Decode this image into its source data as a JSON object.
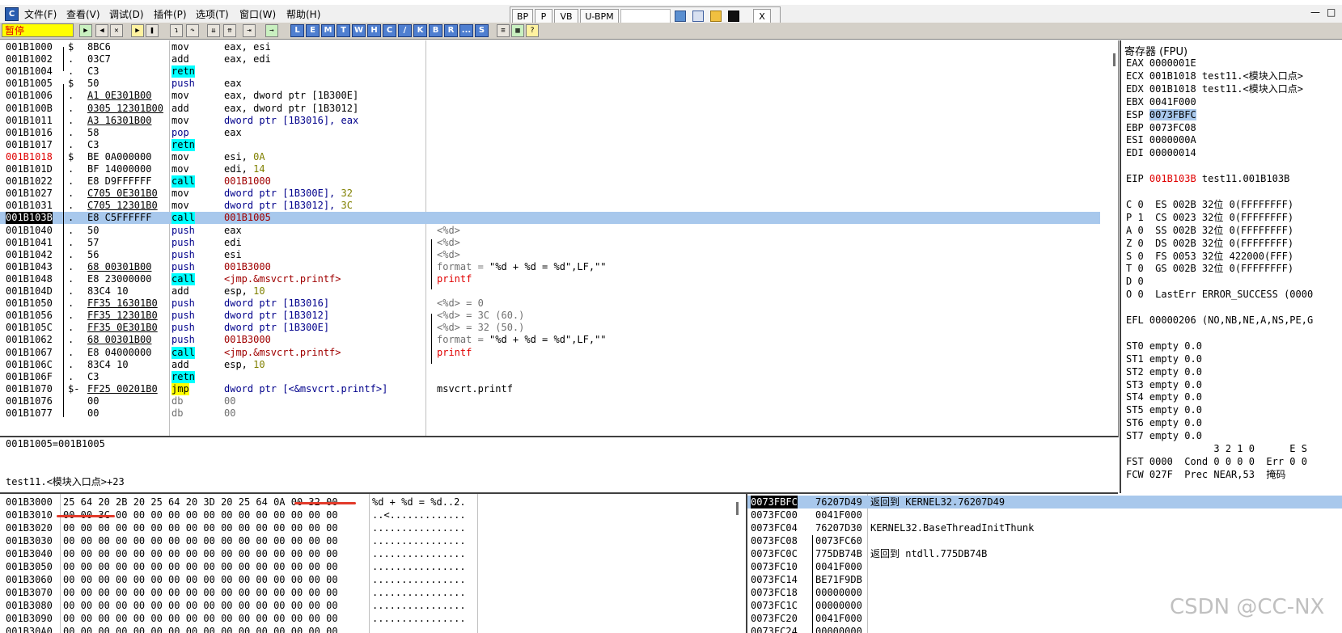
{
  "menu": {
    "items": [
      "文件(F)",
      "查看(V)",
      "调试(D)",
      "插件(P)",
      "选项(T)",
      "窗口(W)",
      "帮助(H)"
    ],
    "window_buttons": [
      "—",
      "□"
    ]
  },
  "plugin_bar": {
    "buttons": [
      "BP",
      "P",
      "VB",
      "U-BPM"
    ],
    "close": "X"
  },
  "toolbar": {
    "status": "暂停",
    "letters": [
      "L",
      "E",
      "M",
      "T",
      "W",
      "H",
      "C",
      "/",
      "K",
      "B",
      "R",
      "...",
      "S"
    ]
  },
  "cpu": {
    "rows": [
      {
        "addr": "001B1000",
        "mark": "$",
        "hex": "8BC6",
        "mn": "mov",
        "op": "eax, esi",
        "cm": ""
      },
      {
        "addr": "001B1002",
        "mark": ".",
        "hex": "03C7",
        "mn": "add",
        "op": "eax, edi",
        "cm": ""
      },
      {
        "addr": "001B1004",
        "mark": ".",
        "hex": "C3",
        "mn": "retn",
        "op": "",
        "cm": ""
      },
      {
        "addr": "001B1005",
        "mark": "$",
        "hex": "50",
        "mn": "push",
        "op": "eax",
        "cm": ""
      },
      {
        "addr": "001B1006",
        "mark": ".",
        "hex": "A1 0E301B00",
        "mn": "mov",
        "op": "eax, dword ptr [1B300E]",
        "cm": ""
      },
      {
        "addr": "001B100B",
        "mark": ".",
        "hex": "0305 12301B00",
        "mn": "add",
        "op": "eax, dword ptr [1B3012]",
        "cm": ""
      },
      {
        "addr": "001B1011",
        "mark": ".",
        "hex": "A3 16301B00",
        "mn": "mov",
        "op": "dword ptr [1B3016], eax",
        "cm": ""
      },
      {
        "addr": "001B1016",
        "mark": ".",
        "hex": "58",
        "mn": "pop",
        "op": "eax",
        "cm": ""
      },
      {
        "addr": "001B1017",
        "mark": ".",
        "hex": "C3",
        "mn": "retn",
        "op": "",
        "cm": ""
      },
      {
        "addr": "001B1018",
        "mark": "$",
        "hex": "BE 0A000000",
        "mn": "mov",
        "op": "esi, 0A",
        "cm": ""
      },
      {
        "addr": "001B101D",
        "mark": ".",
        "hex": "BF 14000000",
        "mn": "mov",
        "op": "edi, 14",
        "cm": ""
      },
      {
        "addr": "001B1022",
        "mark": ".",
        "hex": "E8 D9FFFFFF",
        "mn": "call",
        "op": "001B1000",
        "cm": ""
      },
      {
        "addr": "001B1027",
        "mark": ".",
        "hex": "C705 0E301B0",
        "mn": "mov",
        "op": "dword ptr [1B300E], 32",
        "cm": ""
      },
      {
        "addr": "001B1031",
        "mark": ".",
        "hex": "C705 12301B0",
        "mn": "mov",
        "op": "dword ptr [1B3012], 3C",
        "cm": ""
      },
      {
        "addr": "001B103B",
        "mark": ".",
        "hex": "E8 C5FFFFFF",
        "mn": "call",
        "op": "001B1005",
        "cm": ""
      },
      {
        "addr": "001B1040",
        "mark": ".",
        "hex": "50",
        "mn": "push",
        "op": "eax",
        "cm": "<%d>"
      },
      {
        "addr": "001B1041",
        "mark": ".",
        "hex": "57",
        "mn": "push",
        "op": "edi",
        "cm": "<%d>"
      },
      {
        "addr": "001B1042",
        "mark": ".",
        "hex": "56",
        "mn": "push",
        "op": "esi",
        "cm": "<%d>"
      },
      {
        "addr": "001B1043",
        "mark": ".",
        "hex": "68 00301B00",
        "mn": "push",
        "op": "001B3000",
        "cm": "format = \"%d + %d = %d\",LF,\"\""
      },
      {
        "addr": "001B1048",
        "mark": ".",
        "hex": "E8 23000000",
        "mn": "call",
        "op": "<jmp.&msvcrt.printf>",
        "cm": "printf"
      },
      {
        "addr": "001B104D",
        "mark": ".",
        "hex": "83C4 10",
        "mn": "add",
        "op": "esp, 10",
        "cm": ""
      },
      {
        "addr": "001B1050",
        "mark": ".",
        "hex": "FF35 16301B0",
        "mn": "push",
        "op": "dword ptr [1B3016]",
        "cm": "<%d> = 0"
      },
      {
        "addr": "001B1056",
        "mark": ".",
        "hex": "FF35 12301B0",
        "mn": "push",
        "op": "dword ptr [1B3012]",
        "cm": "<%d> = 3C (60.)"
      },
      {
        "addr": "001B105C",
        "mark": ".",
        "hex": "FF35 0E301B0",
        "mn": "push",
        "op": "dword ptr [1B300E]",
        "cm": "<%d> = 32 (50.)"
      },
      {
        "addr": "001B1062",
        "mark": ".",
        "hex": "68 00301B00",
        "mn": "push",
        "op": "001B3000",
        "cm": "format = \"%d + %d = %d\",LF,\"\""
      },
      {
        "addr": "001B1067",
        "mark": ".",
        "hex": "E8 04000000",
        "mn": "call",
        "op": "<jmp.&msvcrt.printf>",
        "cm": "printf"
      },
      {
        "addr": "001B106C",
        "mark": ".",
        "hex": "83C4 10",
        "mn": "add",
        "op": "esp, 10",
        "cm": ""
      },
      {
        "addr": "001B106F",
        "mark": ".",
        "hex": "C3",
        "mn": "retn",
        "op": "",
        "cm": ""
      },
      {
        "addr": "001B1070",
        "mark": "$-",
        "hex": "FF25 00201B0",
        "mn": "jmp",
        "op": "dword ptr [<&msvcrt.printf>]",
        "cm": "msvcrt.printf"
      },
      {
        "addr": "001B1076",
        "mark": "",
        "hex": "00",
        "mn": "db",
        "op": "00",
        "cm": ""
      },
      {
        "addr": "001B1077",
        "mark": "",
        "hex": "00",
        "mn": "db",
        "op": "00",
        "cm": ""
      }
    ]
  },
  "info": {
    "line1": "001B1005=001B1005",
    "line2": "test11.<模块入口点>+23"
  },
  "registers": {
    "title": "寄存器 (FPU)",
    "lines": [
      "EAX 0000001E",
      "ECX 001B1018 test11.<模块入口点>",
      "EDX 001B1018 test11.<模块入口点>",
      "EBX 0041F000",
      "ESP 0073FBFC",
      "EBP 0073FC08",
      "ESI 0000000A",
      "EDI 00000014",
      "",
      "EIP 001B103B test11.001B103B",
      "",
      "C 0  ES 002B 32位 0(FFFFFFFF)",
      "P 1  CS 0023 32位 0(FFFFFFFF)",
      "A 0  SS 002B 32位 0(FFFFFFFF)",
      "Z 0  DS 002B 32位 0(FFFFFFFF)",
      "S 0  FS 0053 32位 422000(FFF)",
      "T 0  GS 002B 32位 0(FFFFFFFF)",
      "D 0",
      "O 0  LastErr ERROR_SUCCESS (0000",
      "",
      "EFL 00000206 (NO,NB,NE,A,NS,PE,G",
      "",
      "ST0 empty 0.0",
      "ST1 empty 0.0",
      "ST2 empty 0.0",
      "ST3 empty 0.0",
      "ST4 empty 0.0",
      "ST5 empty 0.0",
      "ST6 empty 0.0",
      "ST7 empty 0.0",
      "               3 2 1 0      E S",
      "FST 0000  Cond 0 0 0 0  Err 0 0",
      "FCW 027F  Prec NEAR,53  掩码"
    ]
  },
  "dump": {
    "rows": [
      {
        "addr": "001B3000",
        "hex": "25 64 20 2B 20 25 64 20 3D 20 25 64 0A 00 32 00",
        "ascii": "%d + %d = %d..2."
      },
      {
        "addr": "001B3010",
        "hex": "00 00 3C 00 00 00 00 00 00 00 00 00 00 00 00 00",
        "ascii": "..<............."
      },
      {
        "addr": "001B3020",
        "hex": "00 00 00 00 00 00 00 00 00 00 00 00 00 00 00 00",
        "ascii": "................"
      },
      {
        "addr": "001B3030",
        "hex": "00 00 00 00 00 00 00 00 00 00 00 00 00 00 00 00",
        "ascii": "................"
      },
      {
        "addr": "001B3040",
        "hex": "00 00 00 00 00 00 00 00 00 00 00 00 00 00 00 00",
        "ascii": "................"
      },
      {
        "addr": "001B3050",
        "hex": "00 00 00 00 00 00 00 00 00 00 00 00 00 00 00 00",
        "ascii": "................"
      },
      {
        "addr": "001B3060",
        "hex": "00 00 00 00 00 00 00 00 00 00 00 00 00 00 00 00",
        "ascii": "................"
      },
      {
        "addr": "001B3070",
        "hex": "00 00 00 00 00 00 00 00 00 00 00 00 00 00 00 00",
        "ascii": "................"
      },
      {
        "addr": "001B3080",
        "hex": "00 00 00 00 00 00 00 00 00 00 00 00 00 00 00 00",
        "ascii": "................"
      },
      {
        "addr": "001B3090",
        "hex": "00 00 00 00 00 00 00 00 00 00 00 00 00 00 00 00",
        "ascii": "................"
      },
      {
        "addr": "001B30A0",
        "hex": "00 00 00 00 00 00 00 00 00 00 00 00 00 00 00 00",
        "ascii": "................"
      }
    ]
  },
  "stack": {
    "rows": [
      {
        "addr": "0073FBFC",
        "val": "76207D49",
        "cm": "返回到 KERNEL32.76207D49"
      },
      {
        "addr": "0073FC00",
        "val": "0041F000",
        "cm": ""
      },
      {
        "addr": "0073FC04",
        "val": "76207D30",
        "cm": "KERNEL32.BaseThreadInitThunk"
      },
      {
        "addr": "0073FC08",
        "val": "0073FC60",
        "cm": ""
      },
      {
        "addr": "0073FC0C",
        "val": "775DB74B",
        "cm": "返回到 ntdll.775DB74B"
      },
      {
        "addr": "0073FC10",
        "val": "0041F000",
        "cm": ""
      },
      {
        "addr": "0073FC14",
        "val": "BE71F9DB",
        "cm": ""
      },
      {
        "addr": "0073FC18",
        "val": "00000000",
        "cm": ""
      },
      {
        "addr": "0073FC1C",
        "val": "00000000",
        "cm": ""
      },
      {
        "addr": "0073FC20",
        "val": "0041F000",
        "cm": ""
      },
      {
        "addr": "0073FC24",
        "val": "00000000",
        "cm": ""
      }
    ]
  },
  "watermark": "CSDN @CC-NX",
  "colors": {
    "accent_selection": "#a8c8ec",
    "status_bg": "#ffff00",
    "annotation_red": "#e23a2a"
  }
}
